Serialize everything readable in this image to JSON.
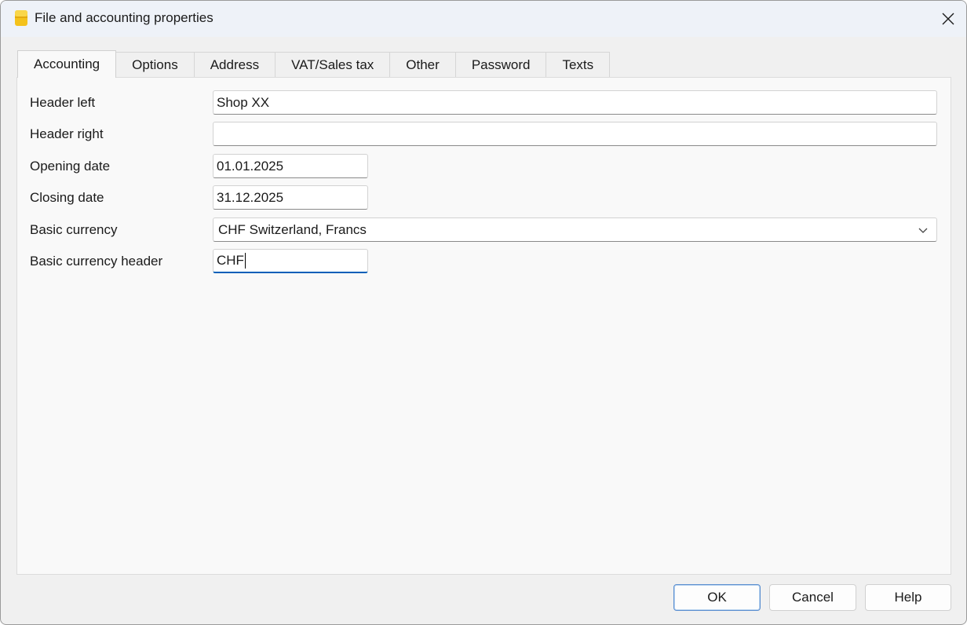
{
  "window": {
    "title": "File and accounting properties",
    "accent_color": "#005fb8"
  },
  "tabs": [
    {
      "label": "Accounting",
      "active": true
    },
    {
      "label": "Options",
      "active": false
    },
    {
      "label": "Address",
      "active": false
    },
    {
      "label": "VAT/Sales tax",
      "active": false
    },
    {
      "label": "Other",
      "active": false
    },
    {
      "label": "Password",
      "active": false
    },
    {
      "label": "Texts",
      "active": false
    }
  ],
  "form": {
    "header_left": {
      "label": "Header left",
      "value": "Shop XX"
    },
    "header_right": {
      "label": "Header right",
      "value": ""
    },
    "opening_date": {
      "label": "Opening date",
      "value": "01.01.2025"
    },
    "closing_date": {
      "label": "Closing date",
      "value": "31.12.2025"
    },
    "basic_currency": {
      "label": "Basic currency",
      "value": "CHF Switzerland, Francs"
    },
    "basic_currency_header": {
      "label": "Basic currency header",
      "value": "CHF"
    }
  },
  "buttons": {
    "ok": "OK",
    "cancel": "Cancel",
    "help": "Help"
  },
  "icons": {
    "app": "banana-app-icon",
    "close": "close-icon",
    "dropdown": "chevron-down-icon"
  }
}
